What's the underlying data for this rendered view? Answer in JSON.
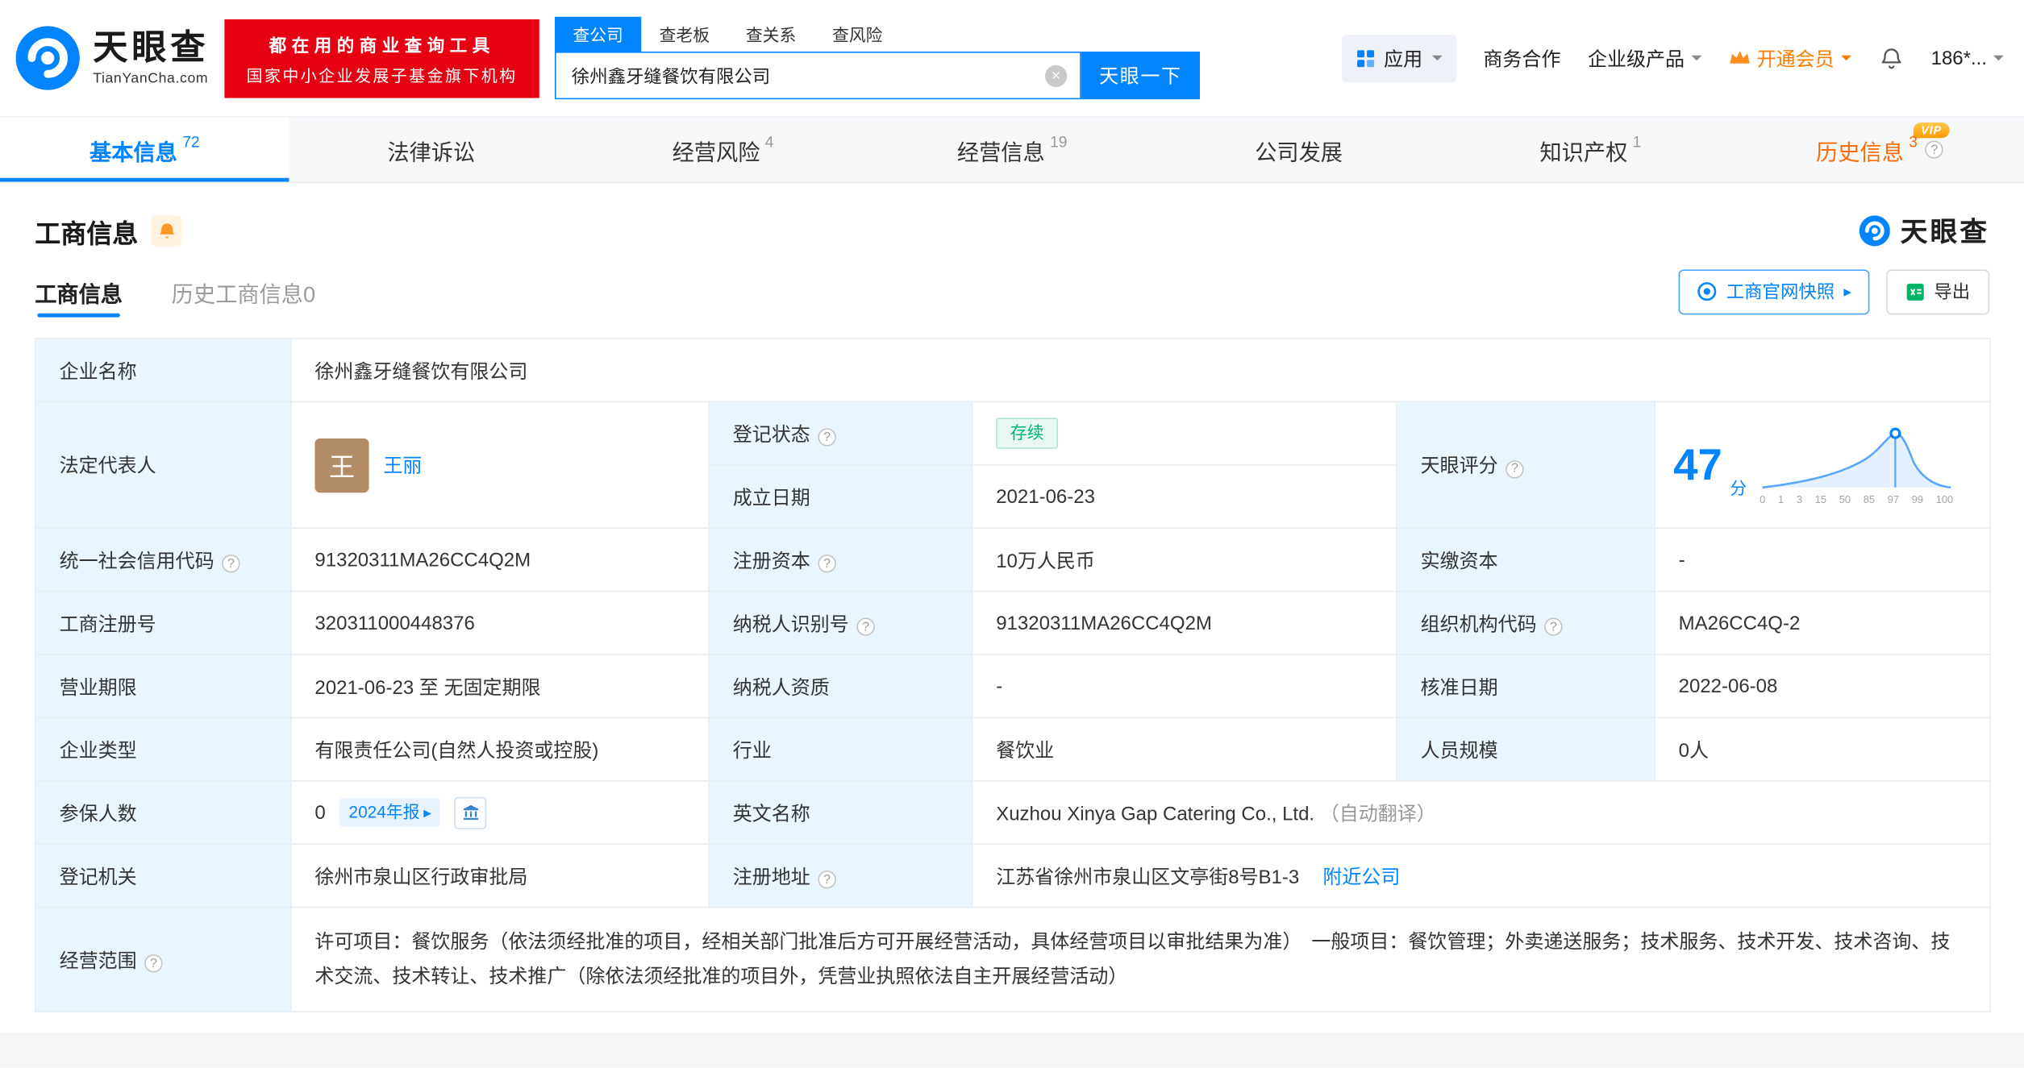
{
  "header": {
    "logo": {
      "name_cn": "天眼查",
      "domain": "TianYanCha.com"
    },
    "banner": {
      "line1": "都在用的商业查询工具",
      "line2": "国家中小企业发展子基金旗下机构"
    },
    "search": {
      "tabs": [
        {
          "label": "查公司"
        },
        {
          "label": "查老板"
        },
        {
          "label": "查关系"
        },
        {
          "label": "查风险"
        }
      ],
      "value": "徐州鑫牙缝餐饮有限公司",
      "button_label": "天眼一下"
    },
    "menu": {
      "apps": "应用",
      "cooperation": "商务合作",
      "enterprise_products": "企业级产品",
      "vip": "开通会员",
      "user": "186*..."
    }
  },
  "nav": {
    "tabs": [
      {
        "label": "基本信息",
        "count": "72"
      },
      {
        "label": "法律诉讼",
        "count": ""
      },
      {
        "label": "经营风险",
        "count": "4"
      },
      {
        "label": "经营信息",
        "count": "19"
      },
      {
        "label": "公司发展",
        "count": ""
      },
      {
        "label": "知识产权",
        "count": "1"
      },
      {
        "label": "历史信息",
        "count": "3",
        "vip_tag": "VIP"
      }
    ]
  },
  "section": {
    "title": "工商信息",
    "brand": "天眼查",
    "sub_tabs": [
      {
        "label": "工商信息"
      },
      {
        "label": "历史工商信息0"
      }
    ],
    "snapshot_button": "工商官网快照",
    "export_button": "导出"
  },
  "info": {
    "company_name_label": "企业名称",
    "company_name": "徐州鑫牙缝餐饮有限公司",
    "legal_rep_label": "法定代表人",
    "legal_rep_avatar": "王",
    "legal_rep_name": "王丽",
    "reg_status_label": "登记状态",
    "reg_status": "存续",
    "establish_date_label": "成立日期",
    "establish_date": "2021-06-23",
    "score_label": "天眼评分",
    "score_value": "47",
    "score_unit": "分",
    "score_axis": [
      "0",
      "1",
      "3",
      "15",
      "50",
      "85",
      "97",
      "99",
      "100"
    ],
    "credit_code_label": "统一社会信用代码",
    "credit_code": "91320311MA26CC4Q2M",
    "reg_capital_label": "注册资本",
    "reg_capital": "10万人民币",
    "paid_capital_label": "实缴资本",
    "paid_capital": "-",
    "reg_number_label": "工商注册号",
    "reg_number": "320311000448376",
    "taxpayer_id_label": "纳税人识别号",
    "taxpayer_id": "91320311MA26CC4Q2M",
    "org_code_label": "组织机构代码",
    "org_code": "MA26CC4Q-2",
    "business_term_label": "营业期限",
    "business_term": "2021-06-23 至 无固定期限",
    "taxpayer_quality_label": "纳税人资质",
    "taxpayer_quality": "-",
    "approval_date_label": "核准日期",
    "approval_date": "2022-06-08",
    "company_type_label": "企业类型",
    "company_type": "有限责任公司(自然人投资或控股)",
    "industry_label": "行业",
    "industry": "餐饮业",
    "staff_size_label": "人员规模",
    "staff_size": "0人",
    "insured_label": "参保人数",
    "insured_count": "0",
    "insured_badge": "2024年报",
    "english_name_label": "英文名称",
    "english_name": "Xuzhou Xinya Gap Catering Co., Ltd.",
    "english_name_note": "（自动翻译）",
    "reg_authority_label": "登记机关",
    "reg_authority": "徐州市泉山区行政审批局",
    "address_label": "注册地址",
    "address": "江苏省徐州市泉山区文亭街8号B1-3",
    "address_link": "附近公司",
    "business_scope_label": "经营范围",
    "business_scope": "许可项目：餐饮服务（依法须经批准的项目，经相关部门批准后方可开展经营活动，具体经营项目以审批结果为准）　一般项目：餐饮管理；外卖递送服务；技术服务、技术开发、技术咨询、技术交流、技术转让、技术推广（除依法须经批准的项目外，凭营业执照依法自主开展经营活动）"
  },
  "colors": {
    "primary_blue": "#0084ff",
    "banner_red": "#e60012",
    "vip_orange": "#ff7b00",
    "status_green": "#00b377",
    "history_orange": "#ff6a00",
    "label_cell_bg": "#e9f6fd"
  }
}
